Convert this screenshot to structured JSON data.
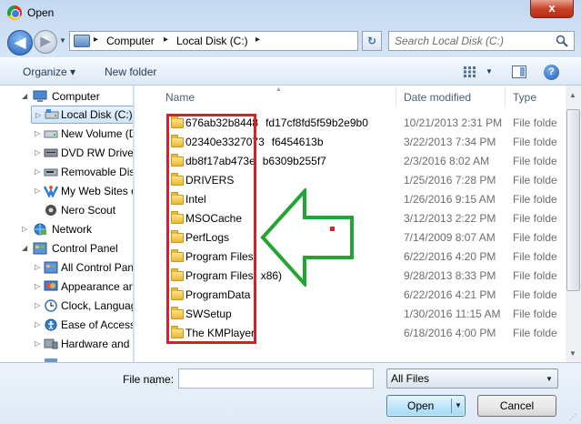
{
  "window": {
    "title": "Open",
    "close_label": "x"
  },
  "address_bar": {
    "crumbs": [
      "Computer",
      "Local Disk (C:)"
    ],
    "separators": [
      "▸",
      "▸",
      "▸"
    ],
    "back_label": "◀",
    "forward_label": "▶",
    "refresh_label": "↻"
  },
  "search": {
    "placeholder": "Search Local Disk (C:)"
  },
  "toolbar": {
    "organize_label": "Organize ▾",
    "new_folder_label": "New folder"
  },
  "nav_pane": {
    "items": [
      {
        "label": "Computer",
        "icon": "computer-icon",
        "level": 0,
        "expanded": true
      },
      {
        "label": "Local Disk (C:)",
        "icon": "drive-icon",
        "level": 1,
        "selected": true
      },
      {
        "label": "New Volume (D",
        "icon": "drive-icon",
        "level": 1
      },
      {
        "label": "DVD RW Drive (",
        "icon": "dvd-icon",
        "level": 1
      },
      {
        "label": "Removable Dis",
        "icon": "removable-drive-icon",
        "level": 1
      },
      {
        "label": "My Web Sites o",
        "icon": "web-sites-icon",
        "level": 1
      },
      {
        "label": "Nero Scout",
        "icon": "nero-icon",
        "level": 1
      },
      {
        "label": "Network",
        "icon": "network-icon",
        "level": 0
      },
      {
        "label": "Control Panel",
        "icon": "control-panel-icon",
        "level": 0,
        "expanded": true
      },
      {
        "label": "All Control Pan",
        "icon": "control-panel-icon",
        "level": 1
      },
      {
        "label": "Appearance an",
        "icon": "appearance-icon",
        "level": 1
      },
      {
        "label": "Clock, Languag",
        "icon": "clock-icon",
        "level": 1
      },
      {
        "label": "Ease of Access",
        "icon": "ease-of-access-icon",
        "level": 1
      },
      {
        "label": "Hardware and S",
        "icon": "hardware-icon",
        "level": 1
      }
    ]
  },
  "file_list": {
    "columns": [
      "Name",
      "Date modified",
      "Type"
    ],
    "rows": [
      {
        "name": "676ab32b8448",
        "name_tail": "fd17cf8fd5f59b2e9b0",
        "date": "10/21/2013 2:31 PM",
        "type": "File folde"
      },
      {
        "name": "02340e3327073",
        "name_tail": "f6454613b",
        "date": "3/22/2013 7:34 PM",
        "type": "File folde"
      },
      {
        "name": "db8f17ab473e",
        "name_tail": "b6309b255f7",
        "date": "2/3/2016 8:02 AM",
        "type": "File folde"
      },
      {
        "name": "DRIVERS",
        "name_tail": "",
        "date": "1/25/2016 7:28 PM",
        "type": "File folde"
      },
      {
        "name": "Intel",
        "name_tail": "",
        "date": "1/26/2016 9:15 AM",
        "type": "File folde"
      },
      {
        "name": "MSOCache",
        "name_tail": "",
        "date": "3/12/2013 2:22 PM",
        "type": "File folde"
      },
      {
        "name": "PerfLogs",
        "name_tail": "",
        "date": "7/14/2009 8:07 AM",
        "type": "File folde"
      },
      {
        "name": "Program Files",
        "name_tail": "",
        "date": "6/22/2016 4:20 PM",
        "type": "File folde"
      },
      {
        "name": "Program Files",
        "name_tail": "x86)",
        "date": "9/28/2013 8:33 PM",
        "type": "File folde"
      },
      {
        "name": "ProgramData",
        "name_tail": "",
        "date": "6/22/2016 4:21 PM",
        "type": "File folde"
      },
      {
        "name": "SWSetup",
        "name_tail": "",
        "date": "1/30/2016 11:15 AM",
        "type": "File folde"
      },
      {
        "name": "The KMPlayer",
        "name_tail": "",
        "date": "6/18/2016 4:00 PM",
        "type": "File folde"
      }
    ]
  },
  "bottom": {
    "file_name_label": "File name:",
    "file_name_value": "",
    "file_type_value": "All Files",
    "open_label": "Open",
    "cancel_label": "Cancel"
  },
  "colors": {
    "annotation_box": "#e21b24",
    "annotation_arrow": "#22a532",
    "selection": "#d0e5fb"
  }
}
